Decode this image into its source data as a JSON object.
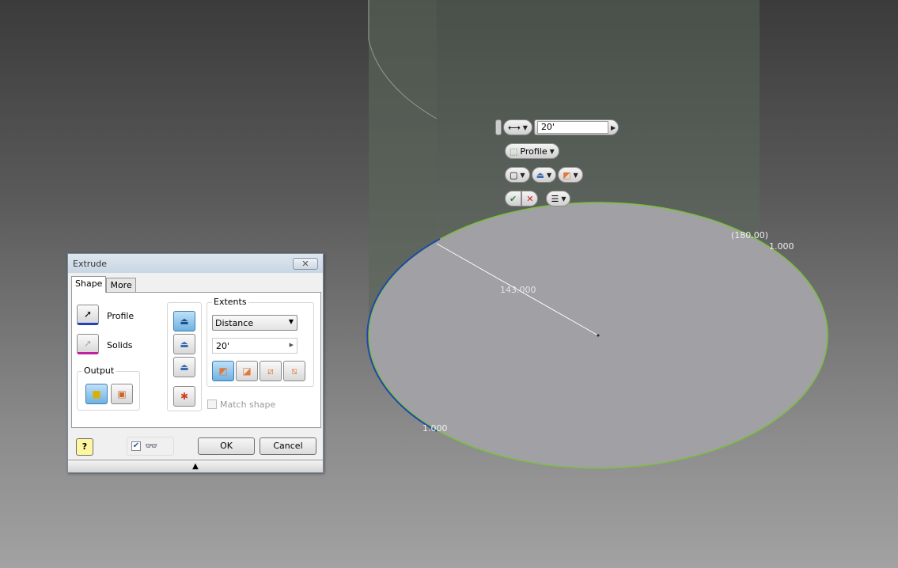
{
  "viewport": {
    "dimensions": {
      "diameter": "143.000",
      "angle": "(180.00)",
      "offset_right": "1.000",
      "offset_left": "1.000"
    },
    "mini_toolbar": {
      "distance_value": "20'",
      "profile_label": "Profile"
    }
  },
  "dialog": {
    "title": "Extrude",
    "tabs": [
      {
        "label": "Shape"
      },
      {
        "label": "More"
      }
    ],
    "profile_label": "Profile",
    "solids_label": "Solids",
    "output_label": "Output",
    "extents_label": "Extents",
    "extents_type": "Distance",
    "distance_value": "20'",
    "match_shape_label": "Match shape",
    "match_shape_checked": false,
    "preview_checked": true,
    "ok_label": "OK",
    "cancel_label": "Cancel"
  }
}
